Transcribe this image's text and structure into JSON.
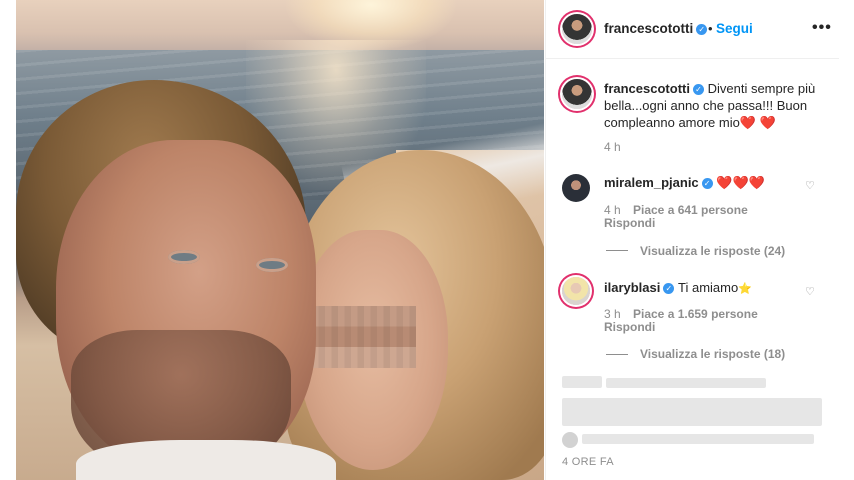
{
  "post": {
    "author": "francescototti",
    "verified_badge": "✓",
    "separator": "•",
    "follow_label": "Segui",
    "more_label": "•••"
  },
  "caption": {
    "username": "francescototti",
    "text": "Diventi sempre più bella...ogni anno che passa!!! Buon compleanno amore mio",
    "emoji": "❤️ ❤️",
    "time": "4 h"
  },
  "comments": [
    {
      "username": "miralem_pjanic",
      "text": "",
      "emoji": "❤️❤️❤️",
      "time": "4 h",
      "likes": "Piace a 641 persone",
      "reply": "Rispondi",
      "view_replies": "Visualizza le risposte (24)",
      "like_icon": "heart-outline-icon"
    },
    {
      "username": "ilaryblasi",
      "text": "Ti amiamo",
      "emoji": "⭐",
      "time": "3 h",
      "likes": "Piace a 1.659 persone",
      "reply": "Rispondi",
      "view_replies": "Visualizza le risposte (18)",
      "like_icon": "heart-outline-icon"
    }
  ],
  "footer": {
    "time": "4 ORE FA"
  },
  "colors": {
    "link": "#0095f6",
    "verified": "#3897f0",
    "muted": "#8e8e8e",
    "story_ring": "#e1306c"
  }
}
